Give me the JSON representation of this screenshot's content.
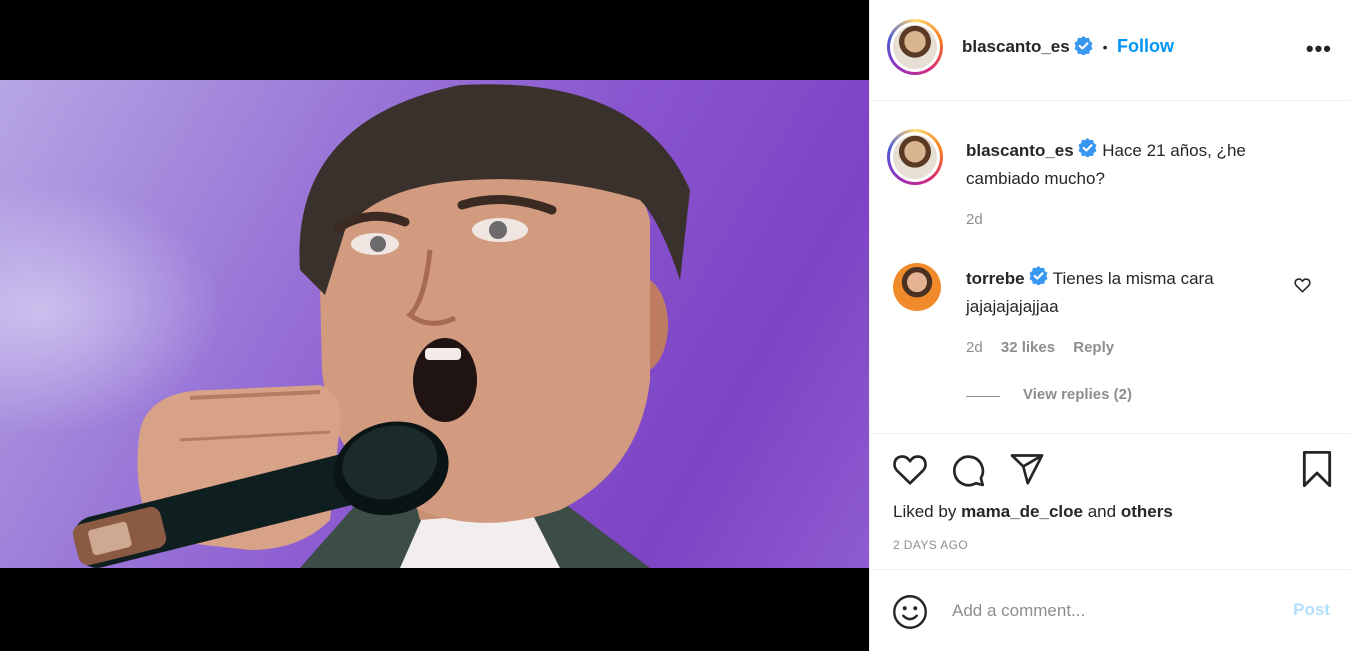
{
  "post": {
    "author": "blascanto_es",
    "follow_label": "Follow",
    "separator": "•",
    "more_label": "•••"
  },
  "caption": {
    "author": "blascanto_es",
    "text_line1": "Hace 21 años, ¿he",
    "text_line2": "cambiado mucho?",
    "time": "2d"
  },
  "comment": {
    "author": "torrebe",
    "text_line1": "Tienes la misma cara",
    "text_line2": "jajajajajajjaa",
    "time": "2d",
    "likes": "32 likes",
    "reply_label": "Reply",
    "view_replies": "View replies (2)"
  },
  "likes": {
    "prefix": "Liked by",
    "user": "mama_de_cloe",
    "middle": "and",
    "others": "others"
  },
  "post_age": "2 DAYS AGO",
  "add_comment": {
    "placeholder": "Add a comment...",
    "post_label": "Post"
  },
  "icons": [
    "verified-badge-icon",
    "more-options-icon",
    "heart-icon",
    "comment-icon",
    "share-icon",
    "bookmark-icon",
    "emoji-icon",
    "like-comment-heart-icon"
  ],
  "colors": {
    "accent": "#0095f6",
    "post_disabled": "#b2dffc",
    "muted": "#8e8e8e",
    "text": "#262626"
  }
}
